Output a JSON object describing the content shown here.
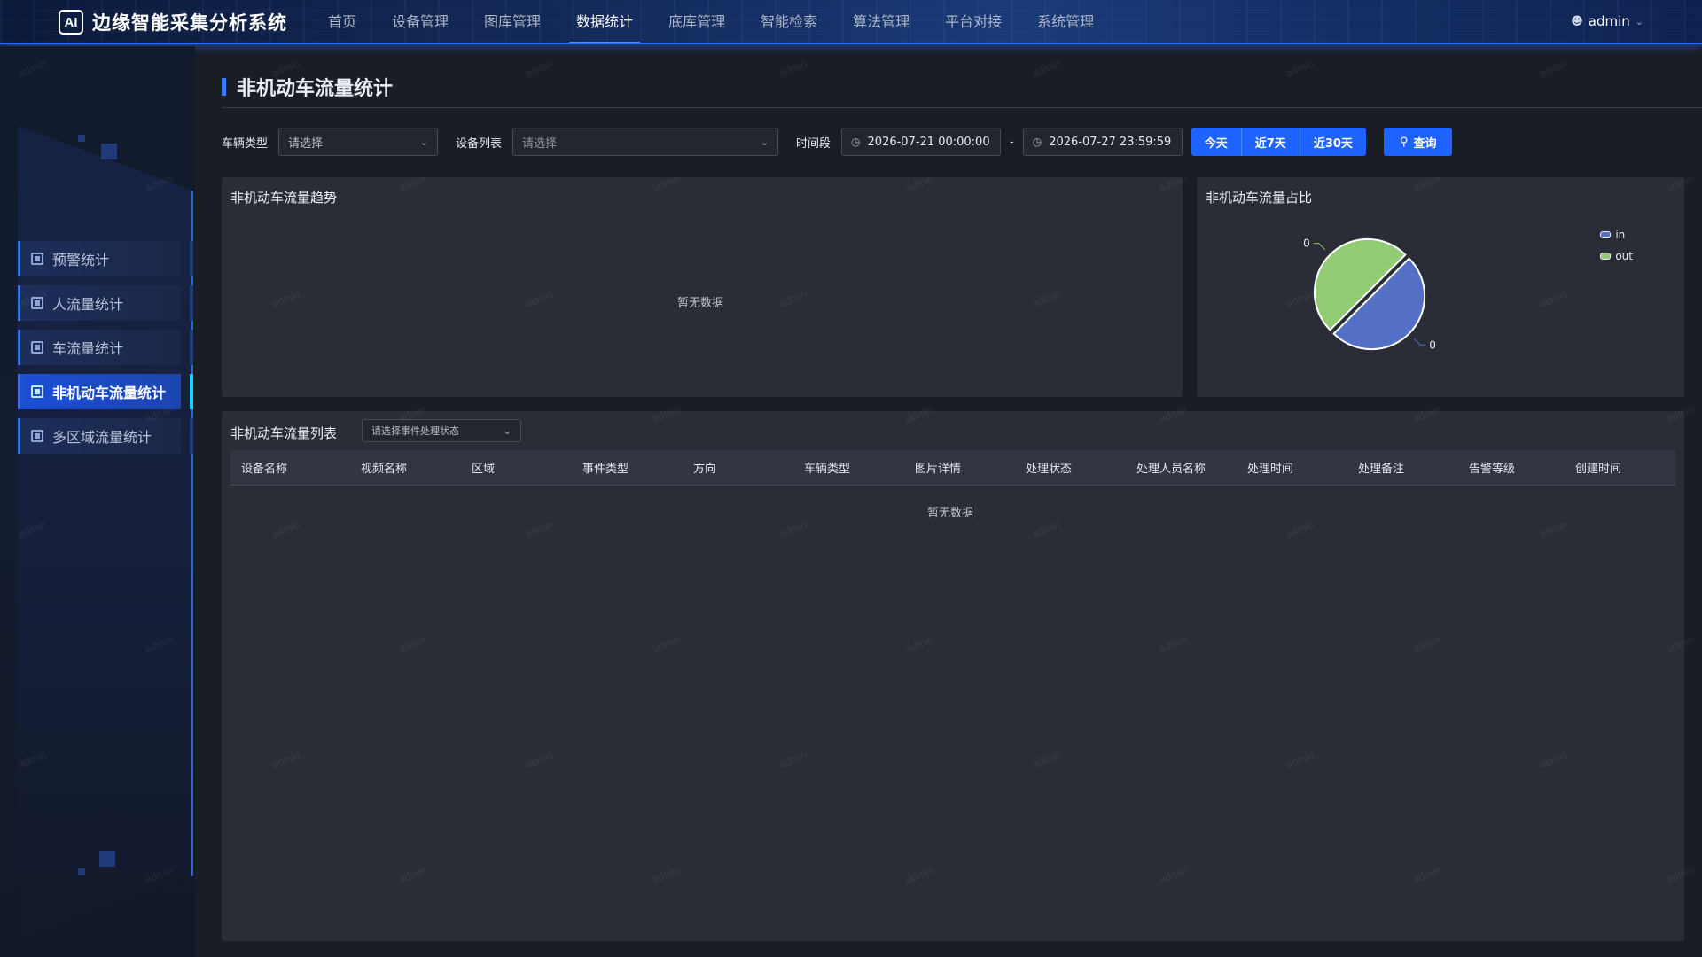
{
  "header": {
    "logo": "AI",
    "title": "边缘智能采集分析系统",
    "nav": [
      "首页",
      "设备管理",
      "图库管理",
      "数据统计",
      "底库管理",
      "智能检索",
      "算法管理",
      "平台对接",
      "系统管理"
    ],
    "active_nav": "数据统计",
    "user": "admin"
  },
  "sidebar": {
    "items": [
      {
        "label": "预警统计"
      },
      {
        "label": "人流量统计"
      },
      {
        "label": "车流量统计"
      },
      {
        "label": "非机动车流量统计"
      },
      {
        "label": "多区域流量统计"
      }
    ],
    "active_item": "非机动车流量统计"
  },
  "page": {
    "title": "非机动车流量统计"
  },
  "filters": {
    "vehicle_type_label": "车辆类型",
    "vehicle_type_placeholder": "请选择",
    "device_list_label": "设备列表",
    "device_list_placeholder": "请选择",
    "period_label": "时间段",
    "start": "2026-07-21 00:00:00",
    "separator": "-",
    "end": "2026-07-27 23:59:59",
    "quick": [
      "今天",
      "近7天",
      "近30天"
    ],
    "query": "查询"
  },
  "trend_card": {
    "title": "非机动车流量趋势",
    "empty": "暂无数据"
  },
  "ratio_card": {
    "title": "非机动车流量占比"
  },
  "chart_data": {
    "type": "pie",
    "title": "非机动车流量占比",
    "series": [
      {
        "name": "in",
        "value": 0,
        "color": "#5470c6"
      },
      {
        "name": "out",
        "value": 0,
        "color": "#91cc75"
      }
    ],
    "data_labels": [
      "0",
      "0"
    ],
    "legend_position": "top-right"
  },
  "list_card": {
    "title": "非机动车流量列表",
    "status_filter_placeholder": "请选择事件处理状态",
    "columns": [
      "设备名称",
      "视频名称",
      "区域",
      "事件类型",
      "方向",
      "车辆类型",
      "图片详情",
      "处理状态",
      "处理人员名称",
      "处理时间",
      "处理备注",
      "告警等级",
      "创建时间"
    ],
    "empty": "暂无数据"
  },
  "watermark": "admin",
  "colors": {
    "accent": "#1e63ff",
    "active_sidebar": "#1a4fd6",
    "sidebar_indicator": "#16d3ff",
    "panel_bg": "#2a2d36"
  }
}
